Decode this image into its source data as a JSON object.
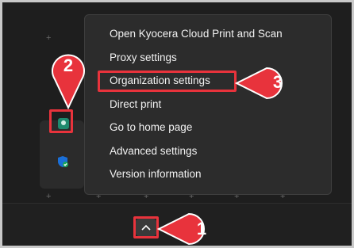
{
  "menu": {
    "items": [
      {
        "label": "Open Kyocera Cloud Print and Scan"
      },
      {
        "label": "Proxy settings"
      },
      {
        "label": "Organization settings"
      },
      {
        "label": "Direct print"
      },
      {
        "label": "Go to home page"
      },
      {
        "label": "Advanced settings"
      },
      {
        "label": "Version information"
      }
    ]
  },
  "tray": {
    "icons": [
      {
        "name": "kyocera-cloud-print-icon"
      },
      {
        "name": "windows-security-icon"
      }
    ],
    "chevron_icon": "chevron-up-icon"
  },
  "callouts": {
    "step1": "1",
    "step2": "2",
    "step3": "3"
  },
  "colors": {
    "highlight": "#e8333c",
    "menu_bg": "#2c2c2c",
    "taskbar_bg": "#202020"
  }
}
